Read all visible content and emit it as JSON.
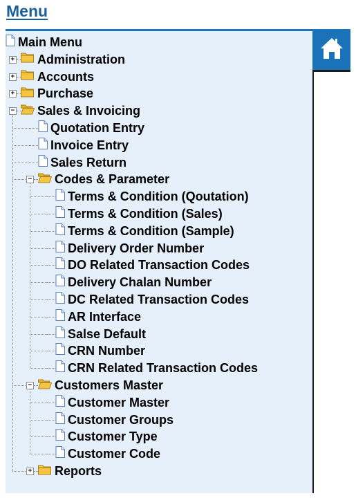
{
  "page": {
    "title": "Menu"
  },
  "tree": {
    "root": "Main Menu",
    "nodes": [
      {
        "label": "Administration",
        "type": "folder",
        "state": "collapsed"
      },
      {
        "label": "Accounts",
        "type": "folder",
        "state": "collapsed"
      },
      {
        "label": "Purchase",
        "type": "folder",
        "state": "collapsed"
      },
      {
        "label": "Sales & Invoicing",
        "type": "folder",
        "state": "expanded",
        "children": [
          {
            "label": "Quotation Entry",
            "type": "page"
          },
          {
            "label": "Invoice Entry",
            "type": "page"
          },
          {
            "label": "Sales Return",
            "type": "page"
          },
          {
            "label": "Codes & Parameter",
            "type": "folder",
            "state": "expanded",
            "children": [
              {
                "label": "Terms & Condition (Qoutation)",
                "type": "page"
              },
              {
                "label": "Terms & Condition (Sales)",
                "type": "page"
              },
              {
                "label": "Terms & Condition (Sample)",
                "type": "page"
              },
              {
                "label": "Delivery Order Number",
                "type": "page"
              },
              {
                "label": "DO Related Transaction Codes",
                "type": "page"
              },
              {
                "label": "Delivery Chalan Number",
                "type": "page"
              },
              {
                "label": "DC Related Transaction Codes",
                "type": "page"
              },
              {
                "label": "AR Interface",
                "type": "page"
              },
              {
                "label": "Salse Default",
                "type": "page"
              },
              {
                "label": "CRN Number",
                "type": "page"
              },
              {
                "label": "CRN Related Transaction Codes",
                "type": "page"
              }
            ]
          },
          {
            "label": "Customers Master",
            "type": "folder",
            "state": "expanded",
            "children": [
              {
                "label": "Customer Master",
                "type": "page"
              },
              {
                "label": "Customer Groups",
                "type": "page"
              },
              {
                "label": "Customer Type",
                "type": "page"
              },
              {
                "label": "Customer Code",
                "type": "page"
              }
            ]
          },
          {
            "label": "Reports",
            "type": "folder",
            "state": "collapsed"
          }
        ]
      }
    ]
  },
  "home_button": {
    "icon": "home-icon"
  },
  "colors": {
    "accent": "#1a73b8",
    "panel_bg": "#e5f0fa",
    "title": "#1a5e9a",
    "folder": "#f5c542"
  }
}
